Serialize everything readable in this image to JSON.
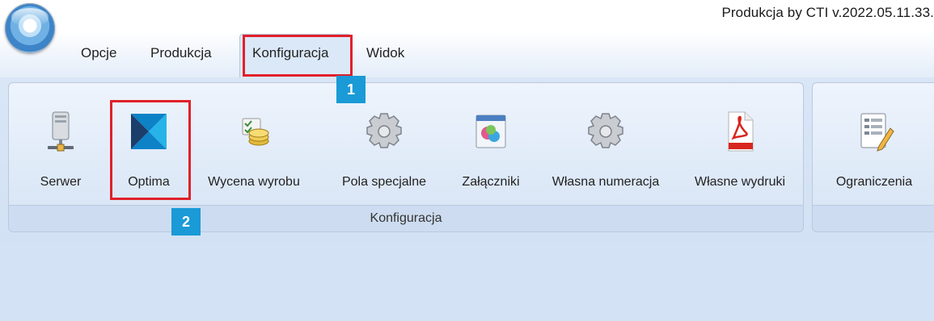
{
  "app": {
    "title": "Produkcja by CTI v.2022.05.11.33.",
    "orb_icon": "app-orb-icon"
  },
  "menu": {
    "tabs": [
      {
        "label": "Opcje"
      },
      {
        "label": "Produkcja"
      },
      {
        "label": "Konfiguracja",
        "active": true
      },
      {
        "label": "Widok"
      }
    ]
  },
  "ribbon": {
    "groups": [
      {
        "label": "Konfiguracja",
        "buttons": [
          {
            "label": "Serwer",
            "icon": "server-icon"
          },
          {
            "label": "Optima",
            "icon": "optima-logo-icon"
          },
          {
            "label": "Wycena wyrobu",
            "icon": "valuation-coins-icon"
          },
          {
            "label": "Pola specjalne",
            "icon": "gear-icon"
          },
          {
            "label": "Załączniki",
            "icon": "attachments-icon"
          },
          {
            "label": "Własna numeracja",
            "icon": "gear-icon"
          },
          {
            "label": "Własne wydruki",
            "icon": "pdf-icon"
          }
        ]
      },
      {
        "label": "",
        "buttons": [
          {
            "label": "Ograniczenia",
            "icon": "restrictions-document-icon"
          }
        ]
      }
    ]
  },
  "annotations": {
    "badge_1": "1",
    "badge_2": "2",
    "highlight_color": "#e0202a",
    "badge_color": "#1a9ad6"
  }
}
